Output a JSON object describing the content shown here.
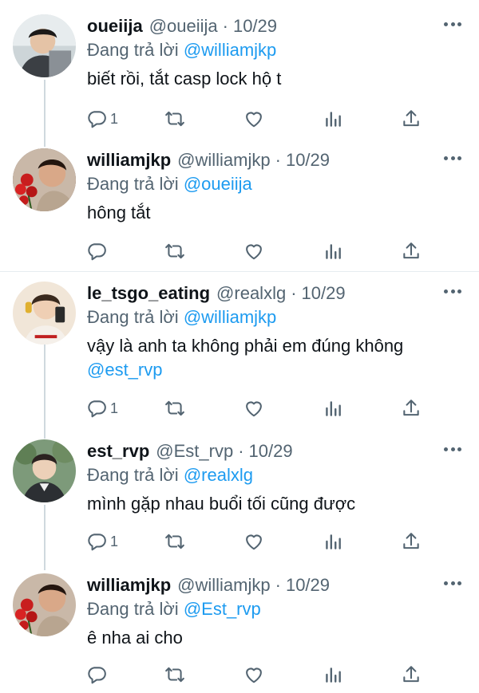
{
  "reply_prefix": "Đang trả lời",
  "tweets": [
    {
      "name": "oueiija",
      "handle": "@oueiija",
      "date": "10/29",
      "reply_to": "@williamjkp",
      "text": "biết rồi, tắt casp lock hộ t",
      "mention_line": "",
      "reply_count": "1"
    },
    {
      "name": "williamjkp",
      "handle": "@williamjkp",
      "date": "10/29",
      "reply_to": "@oueiija",
      "text": "hông tắt",
      "mention_line": "",
      "reply_count": ""
    },
    {
      "name": "le_tsgo_eating",
      "handle": "@realxlg",
      "date": "10/29",
      "reply_to": "@williamjkp",
      "text": "vậy là anh ta không phải em đúng không",
      "mention_line": "@est_rvp",
      "reply_count": "1"
    },
    {
      "name": "est_rvp",
      "handle": "@Est_rvp",
      "date": "10/29",
      "reply_to": "@realxlg",
      "text": "mình gặp nhau buổi tối cũng được",
      "mention_line": "",
      "reply_count": "1"
    },
    {
      "name": "williamjkp",
      "handle": "@williamjkp",
      "date": "10/29",
      "reply_to": "@Est_rvp",
      "text": "ê nha ai cho",
      "mention_line": "",
      "reply_count": ""
    }
  ],
  "colors": {
    "text": "#0f1419",
    "secondary": "#536471",
    "link": "#1d9bf0",
    "thread_line": "#cfd9de",
    "divider": "#e6ecf0"
  },
  "icons": [
    "reply-icon",
    "retweet-icon",
    "like-icon",
    "views-icon",
    "share-icon",
    "more-icon"
  ]
}
